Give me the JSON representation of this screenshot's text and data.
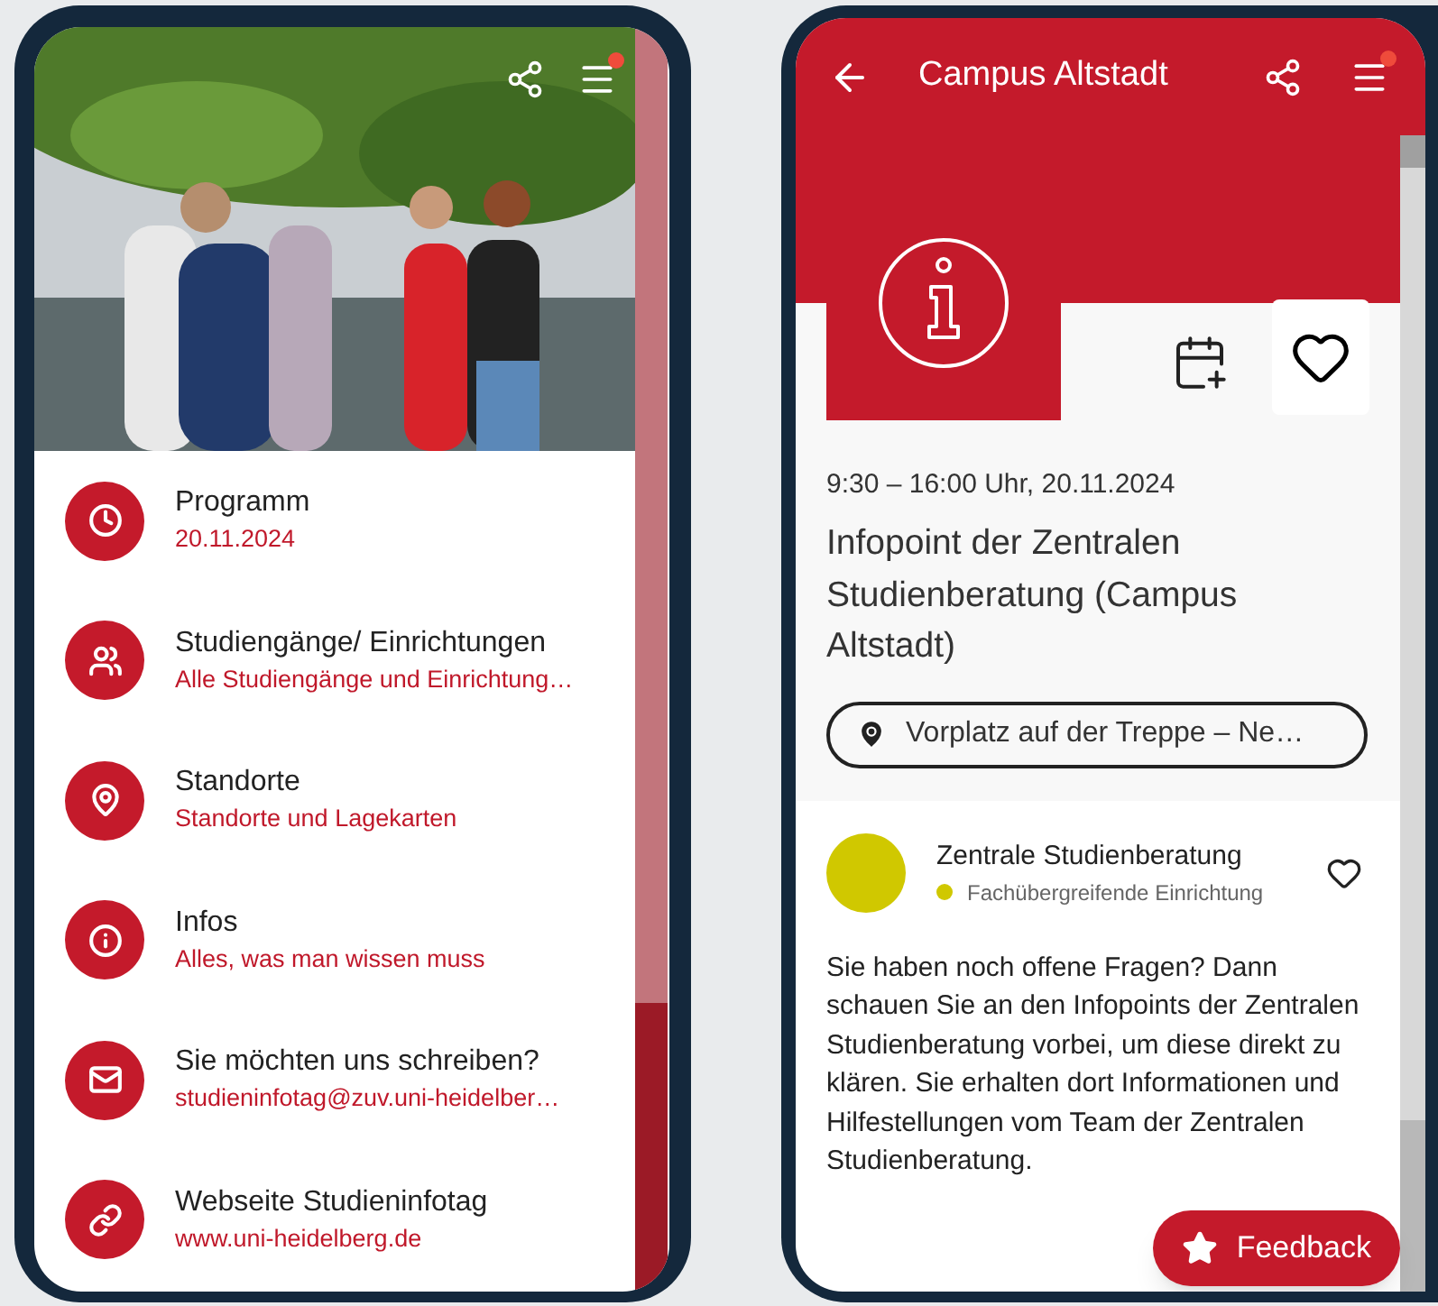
{
  "left_screen": {
    "has_notification": true,
    "menu_items": [
      {
        "kind": "clock",
        "title": "Programm",
        "subtitle": "20.11.2024"
      },
      {
        "kind": "people",
        "title": "Studiengänge/ Einrichtungen",
        "subtitle": "Alle Studiengänge und Einrichtung…"
      },
      {
        "kind": "pin",
        "title": "Standorte",
        "subtitle": "Standorte und Lagekarten"
      },
      {
        "kind": "info",
        "title": "Infos",
        "subtitle": "Alles, was man wissen muss"
      },
      {
        "kind": "mail",
        "title": "Sie möchten uns schreiben?",
        "subtitle": "studieninfotag@zuv.uni-heidelber…"
      },
      {
        "kind": "link",
        "title": "Webseite Studieninfotag",
        "subtitle": "www.uni-heidelberg.de"
      }
    ]
  },
  "right_screen": {
    "title": "Campus Altstadt",
    "has_notification": true,
    "event": {
      "time": "9:30 – 16:00 Uhr, 20.11.2024",
      "title": "Infopoint der Zentralen Studienberatung (Campus Altstadt)",
      "location": "Vorplatz auf der Treppe – Ne…",
      "favorite": false
    },
    "organizer": {
      "name": "Zentrale Studienberatung",
      "category": "Fachübergreifende Einrichtung",
      "color": "#d0c800",
      "favorite": false
    },
    "description": "Sie haben noch offene Fragen? Dann schauen Sie an den Infopoints der Zentralen Studienberatung vorbei, um diese direkt zu klären. Sie erhalten dort Informationen und Hilfestellungen vom Team der Zentralen Studienberatung.",
    "feedback_button": "Feedback"
  }
}
